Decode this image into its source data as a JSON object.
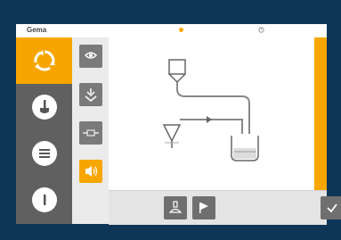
{
  "header": {
    "brand": "Gema",
    "indicators": [
      "status-dot-icon",
      "clock-icon"
    ]
  },
  "nav": {
    "items": [
      {
        "name": "recycle",
        "icon": "recycle-icon",
        "active": true
      },
      {
        "name": "brush",
        "icon": "brush-icon",
        "active": false
      },
      {
        "name": "menu",
        "icon": "list-icon",
        "active": false
      },
      {
        "name": "power",
        "icon": "power-icon",
        "active": false
      }
    ]
  },
  "subnav": {
    "items": [
      {
        "icon": "powder-pump-icon",
        "active": false
      },
      {
        "icon": "fluidize-icon",
        "active": false
      },
      {
        "icon": "sensor-icon",
        "active": false
      },
      {
        "icon": "vibration-icon",
        "active": true
      }
    ]
  },
  "bottombar": {
    "buttons": [
      "hopper-icon",
      "flag-icon",
      "check-icon"
    ]
  },
  "colors": {
    "accent": "#f7a600",
    "nav_bg": "#606060",
    "bezel": "#0e3556"
  }
}
